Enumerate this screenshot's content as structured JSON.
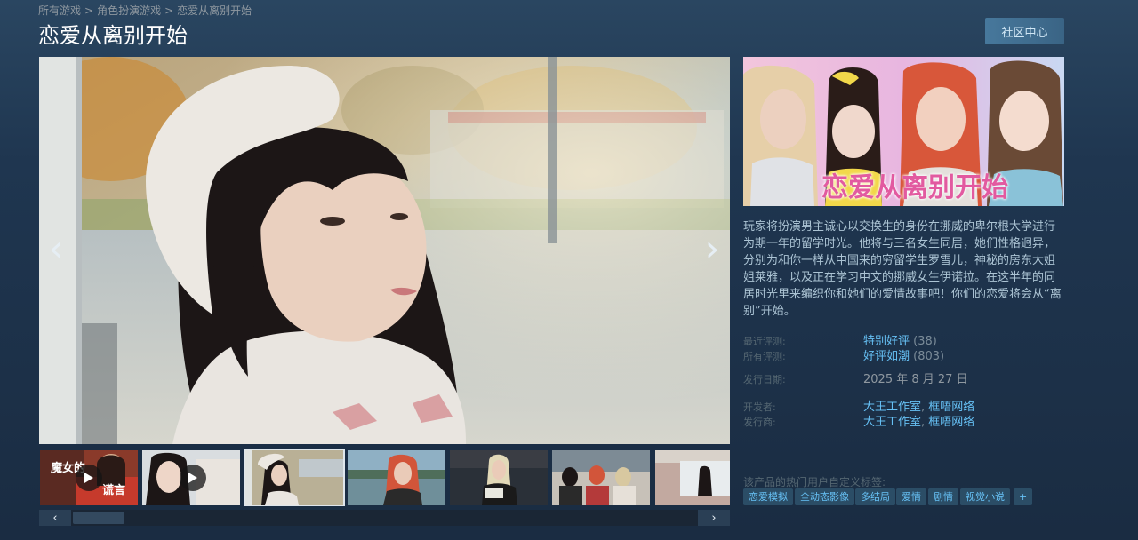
{
  "breadcrumb": [
    "所有游戏",
    "角色扮演游戏",
    "恋爱从离别开始"
  ],
  "breadcrumb_separator": ">",
  "game_title": "恋爱从离别开始",
  "community_button": "社区中心",
  "media_nav": {
    "prev": "‹",
    "next": "›"
  },
  "thumbnails": [
    {
      "kind": "video",
      "label": "魔女的",
      "label2": "谎言"
    },
    {
      "kind": "video"
    },
    {
      "kind": "image",
      "selected": true
    },
    {
      "kind": "image"
    },
    {
      "kind": "image"
    },
    {
      "kind": "image"
    },
    {
      "kind": "image"
    }
  ],
  "scroll": {
    "left": "‹",
    "right": "›"
  },
  "description": "玩家将扮演男主诚心以交换生的身份在挪威的卑尔根大学进行为期一年的留学时光。他将与三名女生同居，她们性格迥异，分别为和你一样从中国来的穷留学生罗雪儿，神秘的房东大姐姐莱雅，以及正在学习中文的挪威女生伊诺拉。在这半年的同居时光里来编织你和她们的爱情故事吧！你们的恋爱将会从“离别”开始。",
  "reviews": {
    "recent_label": "最近评测:",
    "recent_summary": "特别好评",
    "recent_count": "(38)",
    "all_label": "所有评测:",
    "all_summary": "好评如潮",
    "all_count": "(803)"
  },
  "release": {
    "label": "发行日期:",
    "date": "2025 年 8 月 27 日"
  },
  "developer": {
    "label": "开发者:",
    "names": [
      "大王工作室",
      "框唔网络"
    ],
    "separator": ", "
  },
  "publisher": {
    "label": "发行商:",
    "names": [
      "大王工作室",
      "框唔网络"
    ],
    "separator": ", "
  },
  "tags_label": "该产品的热门用户自定义标签:",
  "tags": [
    "恋爱模拟",
    "全动态影像",
    "多结局",
    "爱情",
    "剧情",
    "视觉小说",
    "+"
  ],
  "capsule_logo_text": "恋爱从离别开始",
  "colors": {
    "link": "#66c0f4",
    "tag_bg": "#2b4d66",
    "button_bg": "#3d6c8d"
  }
}
